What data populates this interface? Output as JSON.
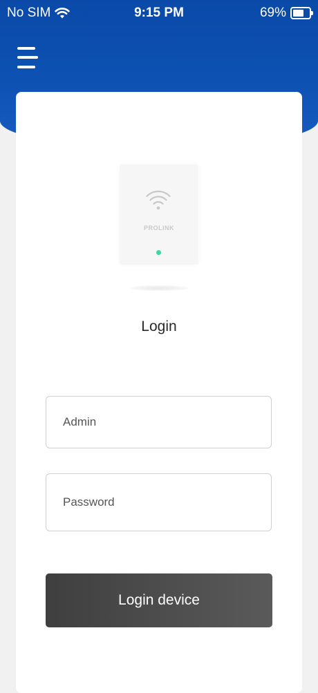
{
  "status_bar": {
    "carrier": "No SIM",
    "time": "9:15 PM",
    "battery": "69%",
    "battery_level": 0.69
  },
  "header": {
    "menu_icon": "hamburger-menu-icon",
    "background_color": "#0d52b3"
  },
  "device": {
    "brand": "PROLINK",
    "wifi_icon": "wifi-icon",
    "led_color": "#3fd6a0"
  },
  "login": {
    "title": "Login",
    "username_placeholder": "Admin",
    "password_placeholder": "Password",
    "button_label": "Login device"
  }
}
